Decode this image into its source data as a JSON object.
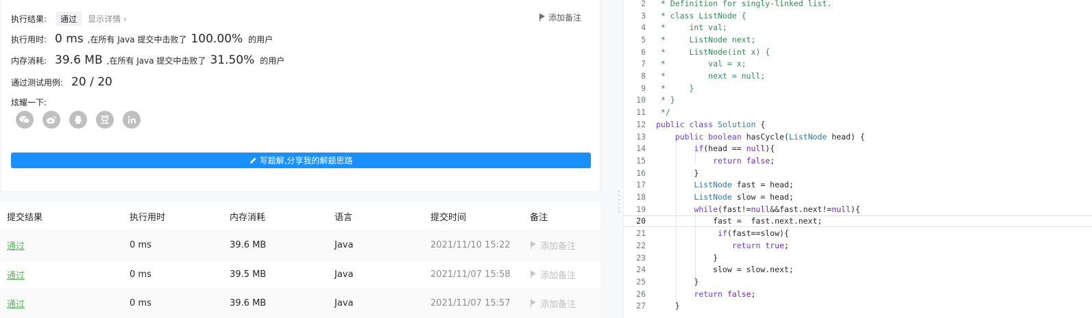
{
  "result": {
    "label": "执行结果:",
    "status": "通过",
    "detail_link": "显示详情 ›",
    "add_note": "添加备注",
    "runtime": {
      "label": "执行用时:",
      "value": "0 ms",
      "middle": ",在所有 Java 提交中击败了",
      "percent": "100.00%",
      "suffix": "的用户"
    },
    "memory": {
      "label": "内存消耗:",
      "value": "39.6 MB",
      "middle": ",在所有 Java 提交中击败了",
      "percent": "31.50%",
      "suffix": "的用户"
    },
    "tests": {
      "label": "通过测试用例:",
      "value": "20 / 20"
    },
    "share_label": "炫耀一下:",
    "share_icons": [
      "wechat-icon",
      "weibo-icon",
      "qq-icon",
      "douban-icon",
      "linkedin-icon"
    ],
    "write_button": "写题解,分享我的解题思路"
  },
  "submissions": {
    "headers": [
      "提交结果",
      "执行用时",
      "内存消耗",
      "语言",
      "提交时间",
      "备注"
    ],
    "rows": [
      {
        "status": "通过",
        "runtime": "0 ms",
        "memory": "39.6 MB",
        "lang": "Java",
        "time": "2021/11/10 15:22",
        "note": "添加备注"
      },
      {
        "status": "通过",
        "runtime": "0 ms",
        "memory": "39.5 MB",
        "lang": "Java",
        "time": "2021/11/07 15:58",
        "note": "添加备注"
      },
      {
        "status": "通过",
        "runtime": "0 ms",
        "memory": "39.6 MB",
        "lang": "Java",
        "time": "2021/11/07 15:57",
        "note": "添加备注"
      }
    ]
  },
  "editor": {
    "active_line": 20,
    "lines": [
      {
        "n": "2",
        "parts": [
          [
            "cm",
            " * Definition for singly-linked list."
          ]
        ]
      },
      {
        "n": "3",
        "parts": [
          [
            "cm",
            " * class ListNode {"
          ]
        ]
      },
      {
        "n": "4",
        "parts": [
          [
            "cm",
            " *     int val;"
          ]
        ]
      },
      {
        "n": "5",
        "parts": [
          [
            "cm",
            " *     ListNode next;"
          ]
        ]
      },
      {
        "n": "6",
        "parts": [
          [
            "cm",
            " *     ListNode(int x) {"
          ]
        ]
      },
      {
        "n": "7",
        "parts": [
          [
            "cm",
            " *         val = x;"
          ]
        ]
      },
      {
        "n": "8",
        "parts": [
          [
            "cm",
            " *         next = null;"
          ]
        ]
      },
      {
        "n": "9",
        "parts": [
          [
            "cm",
            " *     }"
          ]
        ]
      },
      {
        "n": "10",
        "parts": [
          [
            "cm",
            " * }"
          ]
        ]
      },
      {
        "n": "11",
        "parts": [
          [
            "cm",
            " */"
          ]
        ]
      },
      {
        "n": "12",
        "parts": [
          [
            "kw",
            "public class "
          ],
          [
            "ty",
            "Solution"
          ],
          [
            "pl",
            " {"
          ]
        ]
      },
      {
        "n": "13",
        "parts": [
          [
            "pl",
            "    "
          ],
          [
            "kw",
            "public boolean "
          ],
          [
            "fn",
            "hasCycle("
          ],
          [
            "ty",
            "ListNode"
          ],
          [
            "pl",
            " head) {"
          ]
        ]
      },
      {
        "n": "14",
        "parts": [
          [
            "pl",
            "        "
          ],
          [
            "kw",
            "if"
          ],
          [
            "pl",
            "(head == "
          ],
          [
            "lit",
            "null"
          ],
          [
            "pl",
            "){"
          ]
        ]
      },
      {
        "n": "15",
        "parts": [
          [
            "pl",
            "            "
          ],
          [
            "kw",
            "return "
          ],
          [
            "lit",
            "false"
          ],
          [
            "pl",
            ";"
          ]
        ]
      },
      {
        "n": "16",
        "parts": [
          [
            "pl",
            "        }"
          ]
        ]
      },
      {
        "n": "17",
        "parts": [
          [
            "pl",
            "        "
          ],
          [
            "ty",
            "ListNode"
          ],
          [
            "pl",
            " fast = head;"
          ]
        ]
      },
      {
        "n": "18",
        "parts": [
          [
            "pl",
            "        "
          ],
          [
            "ty",
            "ListNode"
          ],
          [
            "pl",
            " slow = head;"
          ]
        ]
      },
      {
        "n": "19",
        "parts": [
          [
            "pl",
            "        "
          ],
          [
            "kw",
            "while"
          ],
          [
            "pl",
            "(fast!="
          ],
          [
            "lit",
            "null"
          ],
          [
            "pl",
            "&&fast.next!="
          ],
          [
            "lit",
            "null"
          ],
          [
            "pl",
            "){"
          ]
        ]
      },
      {
        "n": "20",
        "parts": [
          [
            "pl",
            "            fast =  fast.next.next;"
          ]
        ]
      },
      {
        "n": "21",
        "parts": [
          [
            "pl",
            "             "
          ],
          [
            "kw",
            "if"
          ],
          [
            "pl",
            "(fast==slow){"
          ]
        ]
      },
      {
        "n": "22",
        "parts": [
          [
            "pl",
            "                "
          ],
          [
            "kw",
            "return "
          ],
          [
            "lit",
            "true"
          ],
          [
            "pl",
            ";"
          ]
        ]
      },
      {
        "n": "23",
        "parts": [
          [
            "pl",
            "            }"
          ]
        ]
      },
      {
        "n": "24",
        "parts": [
          [
            "pl",
            "            slow = slow.next;"
          ]
        ]
      },
      {
        "n": "25",
        "parts": [
          [
            "pl",
            "        }"
          ]
        ]
      },
      {
        "n": "26",
        "parts": [
          [
            "pl",
            "        "
          ],
          [
            "kw",
            "return "
          ],
          [
            "lit",
            "false"
          ],
          [
            "pl",
            ";"
          ]
        ]
      },
      {
        "n": "27",
        "parts": [
          [
            "pl",
            "    }"
          ]
        ]
      }
    ]
  }
}
